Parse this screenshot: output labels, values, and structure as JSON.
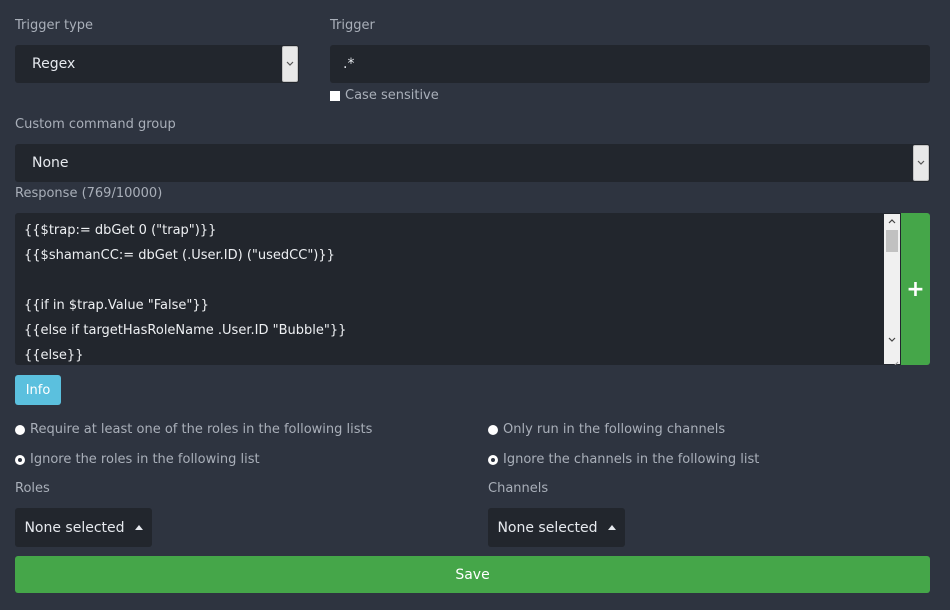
{
  "trigger_type": {
    "label": "Trigger type",
    "selected": "Regex"
  },
  "trigger": {
    "label": "Trigger",
    "value": ".*",
    "case_sensitive_label": "Case sensitive",
    "case_sensitive_checked": false
  },
  "command_group": {
    "label": "Custom command group",
    "selected": "None"
  },
  "response": {
    "label": "Response (769/10000)",
    "lines": [
      "{{$trap:= dbGet 0 (\"trap\")}}",
      "{{$shamanCC:= dbGet (.User.ID) (\"usedCC\")}}",
      "",
      "{{if in $trap.Value \"False\"}}",
      "{{else if targetHasRoleName .User.ID \"Bubble\"}}",
      "{{else}}"
    ],
    "add_label": "+"
  },
  "info_button": {
    "label": "Info"
  },
  "role_mode": {
    "require_label": "Require at least one of the roles in the following lists",
    "ignore_label": "Ignore the roles in the following list",
    "selected": "ignore"
  },
  "channel_mode": {
    "only_label": "Only run in the following channels",
    "ignore_label": "Ignore the channels in the following list",
    "selected": "ignore"
  },
  "roles": {
    "label": "Roles",
    "dropdown_label": "None selected"
  },
  "channels": {
    "label": "Channels",
    "dropdown_label": "None selected"
  },
  "save_button": {
    "label": "Save"
  },
  "colors": {
    "background": "#2e3440",
    "field": "#22262d",
    "green": "#45a649",
    "info": "#5bc0de"
  }
}
